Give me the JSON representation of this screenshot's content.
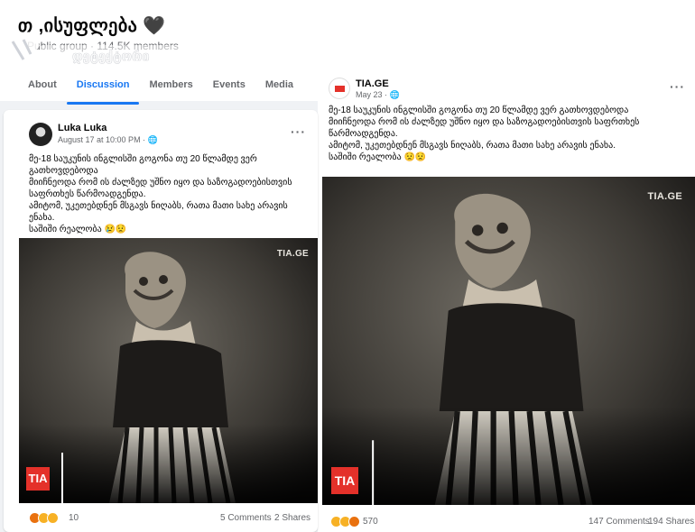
{
  "group": {
    "title": "თ ,ისუფლება 🖤",
    "subtitle": "Public group · 114.5K members",
    "watermark": "დეტექტორი",
    "tabs": [
      "About",
      "Discussion",
      "Members",
      "Events",
      "Media"
    ],
    "active_tab": "Discussion"
  },
  "post_left": {
    "author": "Luka Luka",
    "meta": "August 17 at 10:00 PM · 🌐",
    "menu": "···",
    "lines": [
      "მე-18 საუკუნის ინგლისში გოგონა თუ 20 წლამდე ვერ გათხოვდებოდა",
      "მიიჩნეოდა რომ ის ძალზედ უშნო იყო და საზოგადოებისთვის საფრთხეს წარმოადგენდა.",
      "ამიტომ, უკეთებდნენ მსგავს ნიღაბს, რათა მათი სახე არავის ენახა.",
      "საშიში რეალობა 😢😟"
    ],
    "photo_watermark": "TIA.GE",
    "badge": "TIA",
    "reactions_count": "10",
    "comments": "5 Comments",
    "shares": "2 Shares"
  },
  "post_right": {
    "author": "TIA.GE",
    "meta": "May 23 · 🌐",
    "menu": "···",
    "lines": [
      "მე-18 საუკუნის ინგლისში გოგონა თუ 20 წლამდე ვერ გათხოვდებოდა",
      "მიიჩნეოდა რომ ის ძალზედ უშნო იყო და საზოგადოებისთვის საფრთხეს წარმოადგენდა.",
      "ამიტომ, უკეთებდნენ მსგავს ნიღაბს, რათა მათი სახე არავის ენახა.",
      " საშიში რეალობა 😟😟"
    ],
    "photo_watermark": "TIA.GE",
    "badge": "TIA",
    "reactions_count": "570",
    "comments": "147 Comments",
    "shares": "194 Shares"
  },
  "colors": {
    "accent": "#1877f2",
    "badge": "#e4312a",
    "photo_bg": "#2b2925"
  }
}
